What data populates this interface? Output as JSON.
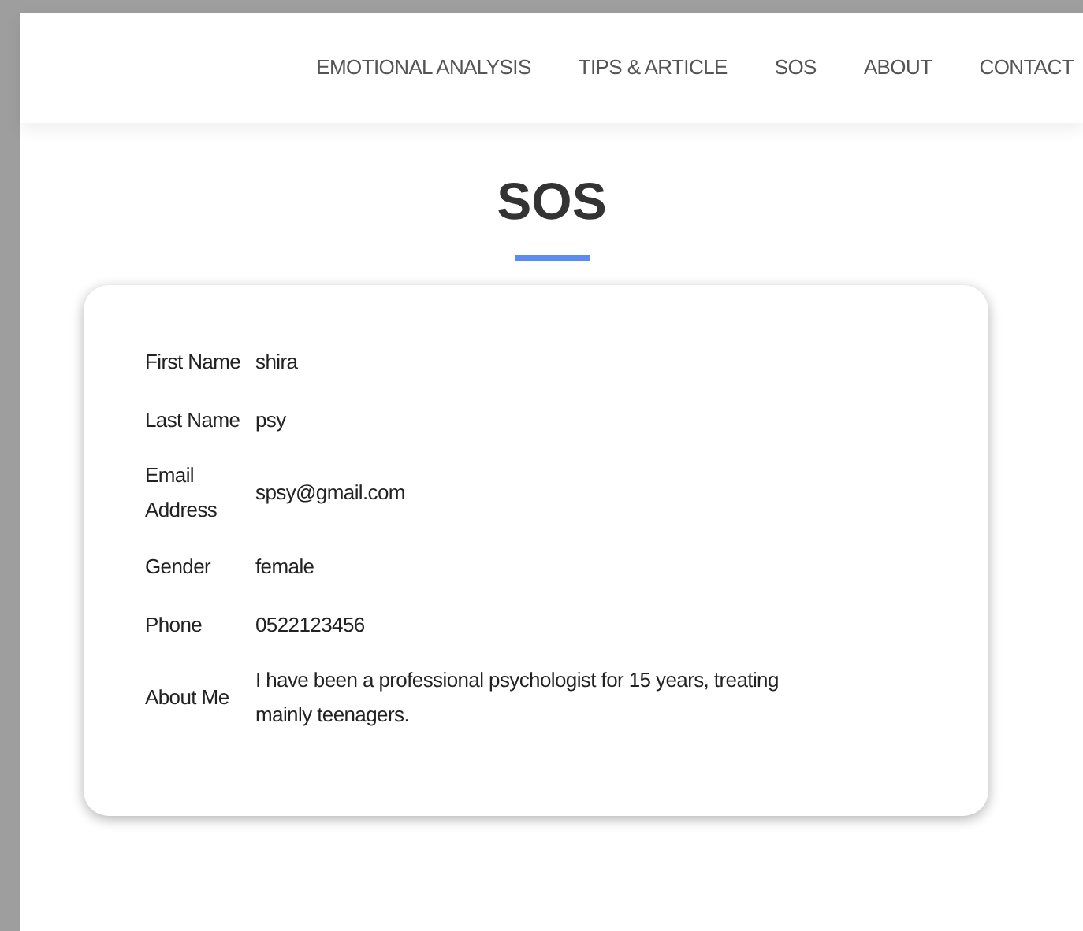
{
  "nav": {
    "items": [
      {
        "label": "EMOTIONAL ANALYSIS",
        "selected": false
      },
      {
        "label": "TIPS & ARTICLE",
        "selected": false
      },
      {
        "label": "SOS",
        "selected": false
      },
      {
        "label": "ABOUT",
        "selected": false
      },
      {
        "label": "CONTACT",
        "selected": false
      }
    ]
  },
  "heading": "SOS",
  "profile": {
    "fields": [
      {
        "label": "First Name",
        "value": "shira"
      },
      {
        "label": "Last Name",
        "value": "psy"
      },
      {
        "label": "Email Address",
        "value": "spsy@gmail.com"
      },
      {
        "label": "Gender",
        "value": "female"
      },
      {
        "label": "Phone",
        "value": "0522123456"
      },
      {
        "label": "About Me",
        "value": "I have been a professional psychologist for 15 years, treating mainly teenagers."
      }
    ]
  }
}
